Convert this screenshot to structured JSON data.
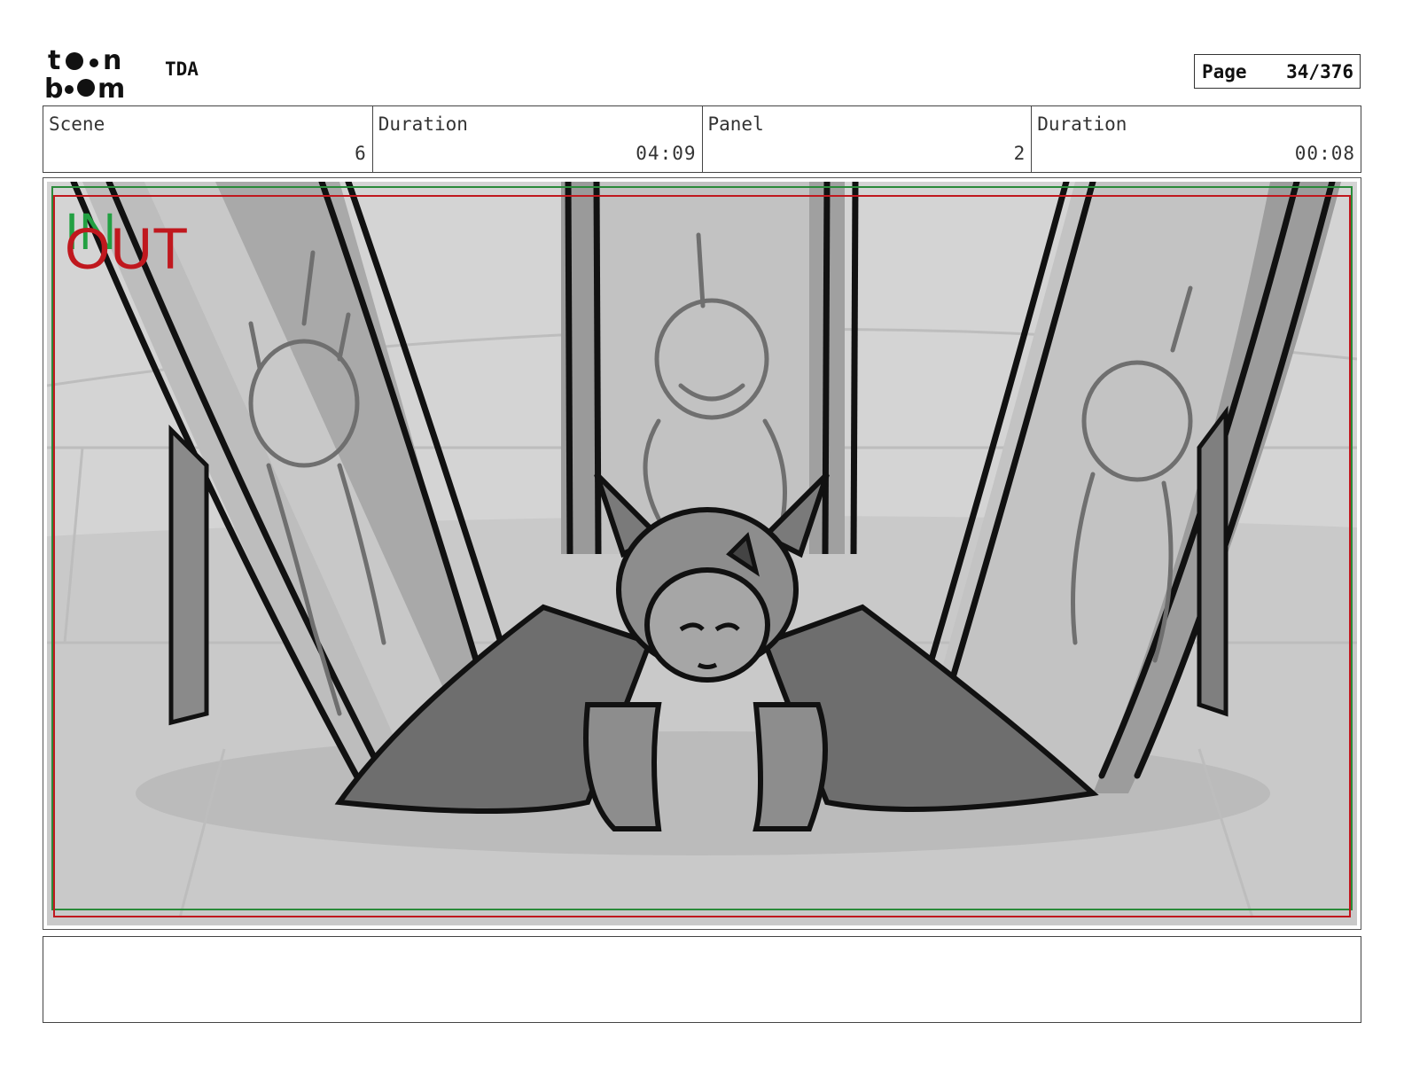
{
  "header": {
    "logo_text_top": "toon",
    "logo_text_bottom": "boom",
    "project_title": "TDA",
    "page_label": "Page",
    "page_number": "34/376"
  },
  "info": {
    "scene_label": "Scene",
    "scene_value": "6",
    "scene_duration_label": "Duration",
    "scene_duration_value": "04:09",
    "panel_label": "Panel",
    "panel_value": "2",
    "panel_duration_label": "Duration",
    "panel_duration_value": "00:08"
  },
  "panel": {
    "in_marker": "IN",
    "out_marker": "OUT",
    "in_color": "#22a042",
    "out_color": "#c0181e",
    "safe_frame_color": "#c0181e",
    "action_frame_color": "#2a8a3a"
  },
  "caption": {
    "text": ""
  }
}
